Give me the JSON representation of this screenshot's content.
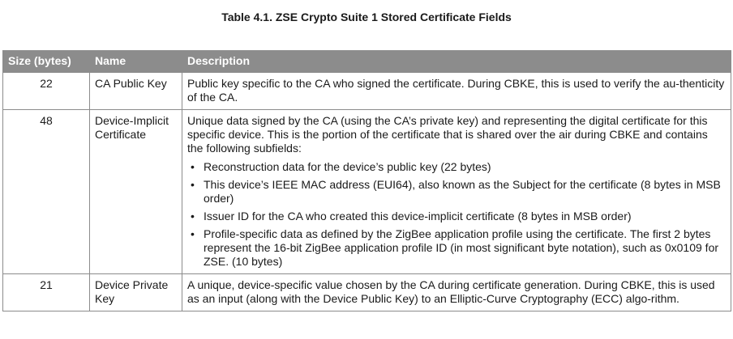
{
  "caption": "Table 4.1.  ZSE Crypto Suite 1 Stored Certificate Fields",
  "headers": {
    "size": "Size (bytes)",
    "name": "Name",
    "description": "Description"
  },
  "rows": [
    {
      "size": "22",
      "name": "CA Public Key",
      "description": "Public key specific to the CA who signed the certificate. During CBKE, this is used to verify the au-thenticity of the CA."
    },
    {
      "size": "48",
      "name": "Device-Implicit Certificate",
      "description": "Unique data signed by the CA (using the CA’s private key) and representing the digital certificate for this specific device. This is the portion of the certificate that is shared over the air during CBKE and contains the following subfields:",
      "bullets": [
        "Reconstruction data for the device’s public key (22 bytes)",
        "This device’s IEEE MAC address (EUI64), also known as the Subject for the certificate (8 bytes in MSB order)",
        "Issuer ID for the CA who created this device-implicit certificate (8 bytes in MSB order)",
        "Profile-specific data as defined by the ZigBee application profile using the certificate. The first 2 bytes represent the 16-bit ZigBee application profile ID (in most significant byte notation), such as 0x0109 for ZSE. (10 bytes)"
      ]
    },
    {
      "size": "21",
      "name": "Device Private Key",
      "description": "A unique, device-specific value chosen by the CA during certificate generation. During CBKE, this is used as an input (along with the Device Public Key) to an Elliptic-Curve Cryptography (ECC) algo-rithm."
    }
  ],
  "bullet_glyph": "•",
  "colors": {
    "header_bg": "#8c8c8c",
    "header_text": "#ffffff",
    "border": "#8c8c8c"
  }
}
